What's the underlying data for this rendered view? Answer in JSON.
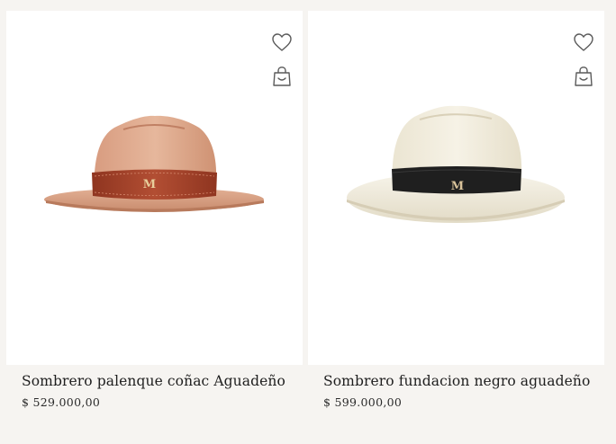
{
  "products": [
    {
      "name": "Sombrero palenque coñac Aguadeño",
      "price": "$ 529.000,00",
      "hat_color": "#dba58a",
      "band_color": "#a7452c",
      "logo_letter": "M",
      "favorite_icon": "heart-outline-icon",
      "cart_icon": "shopping-bag-icon"
    },
    {
      "name": "Sombrero fundacion negro aguadeño",
      "price": "$ 599.000,00",
      "hat_color": "#f0ecdf",
      "band_color": "#1f1f1f",
      "logo_letter": "M",
      "favorite_icon": "heart-outline-icon",
      "cart_icon": "shopping-bag-icon"
    }
  ],
  "colors": {
    "page_background": "#f6f4f1",
    "card_background": "#ffffff",
    "text": "#1e1e1e",
    "icon_stroke": "#5a5a5a"
  }
}
